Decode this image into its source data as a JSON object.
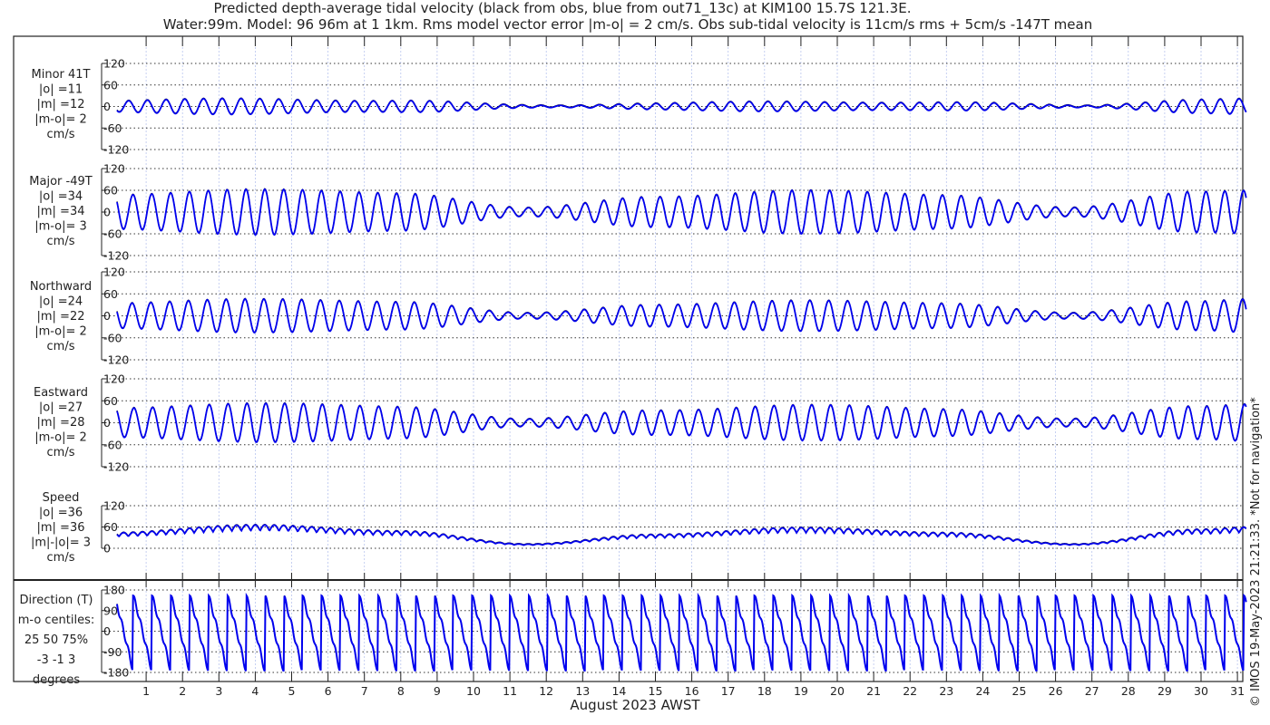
{
  "chart_data": {
    "type": "line",
    "title": "Predicted depth-average tidal velocity (black from obs, blue from out71_13c) at KIM100 15.7S 121.3E.",
    "subtitle": "Water:99m. Model: 96 96m at 1 1km. Rms model vector error |m-o| = 2 cm/s. Obs sub-tidal velocity is 11cm/s rms + 5cm/s -147T mean",
    "xlabel": "August 2023 AWST",
    "xticks": [
      "1",
      "2",
      "3",
      "4",
      "5",
      "6",
      "7",
      "8",
      "9",
      "10",
      "11",
      "12",
      "13",
      "14",
      "15",
      "16",
      "17",
      "18",
      "19",
      "20",
      "21",
      "22",
      "23",
      "24",
      "25",
      "26",
      "27",
      "28",
      "29",
      "30",
      "31"
    ],
    "xlim": [
      0.2,
      31.25
    ],
    "tidal_period_days": 0.5175,
    "credit": "© IMOS 19-May-2023 21:21:33.  *Not for navigation*",
    "series_colors": {
      "obs": "#000000",
      "model": "#0000ee"
    },
    "envelope_days": [
      0,
      4,
      8,
      11.5,
      15,
      19,
      23,
      26.5,
      30,
      31.5
    ],
    "panels": [
      {
        "name": "minor",
        "labels": [
          "Minor 41T",
          "|o| =11",
          "|m| =12",
          "|m-o|= 2",
          "cm/s"
        ],
        "yticks": [
          "120",
          "60",
          "0",
          "-60",
          "-120"
        ],
        "ylim": [
          -120,
          120
        ],
        "envelope": [
          15,
          22,
          15,
          4,
          8,
          14,
          10,
          4,
          18,
          20
        ]
      },
      {
        "name": "major",
        "labels": [
          "Major -49T",
          "|o| =34",
          "|m| =34",
          "|m-o|= 3",
          "cm/s"
        ],
        "yticks": [
          "120",
          "60",
          "0",
          "-60",
          "-120"
        ],
        "ylim": [
          -120,
          120
        ],
        "envelope": [
          45,
          65,
          50,
          14,
          40,
          62,
          45,
          14,
          55,
          60
        ]
      },
      {
        "name": "northward",
        "labels": [
          "Northward",
          "|o| =24",
          "|m| =22",
          "|m-o|= 2",
          "cm/s"
        ],
        "yticks": [
          "120",
          "60",
          "0",
          "-60",
          "-120"
        ],
        "ylim": [
          -120,
          120
        ],
        "envelope": [
          32,
          48,
          36,
          10,
          28,
          44,
          32,
          10,
          38,
          46
        ]
      },
      {
        "name": "eastward",
        "labels": [
          "Eastward",
          "|o| =27",
          "|m| =28",
          "|m-o|= 2",
          "cm/s"
        ],
        "yticks": [
          "120",
          "60",
          "0",
          "-60",
          "-120"
        ],
        "ylim": [
          -120,
          120
        ],
        "envelope": [
          38,
          55,
          42,
          12,
          32,
          50,
          36,
          12,
          44,
          52
        ]
      },
      {
        "name": "speed",
        "labels": [
          "Speed",
          "|o| =36",
          "|m| =36",
          "|m|-|o|= 3",
          "cm/s"
        ],
        "yticks": [
          "120",
          "60",
          "0"
        ],
        "ylim": [
          0,
          120
        ],
        "envelope": [
          45,
          68,
          50,
          12,
          40,
          60,
          45,
          12,
          55,
          62
        ]
      },
      {
        "name": "direction",
        "labels": [
          "Direction (T)",
          "m-o centiles:",
          "25  50  75%",
          "-3 -1  3",
          "degrees"
        ],
        "yticks": [
          "180",
          "90",
          "0",
          "-90",
          "-180"
        ],
        "ylim": [
          -180,
          180
        ]
      }
    ]
  }
}
